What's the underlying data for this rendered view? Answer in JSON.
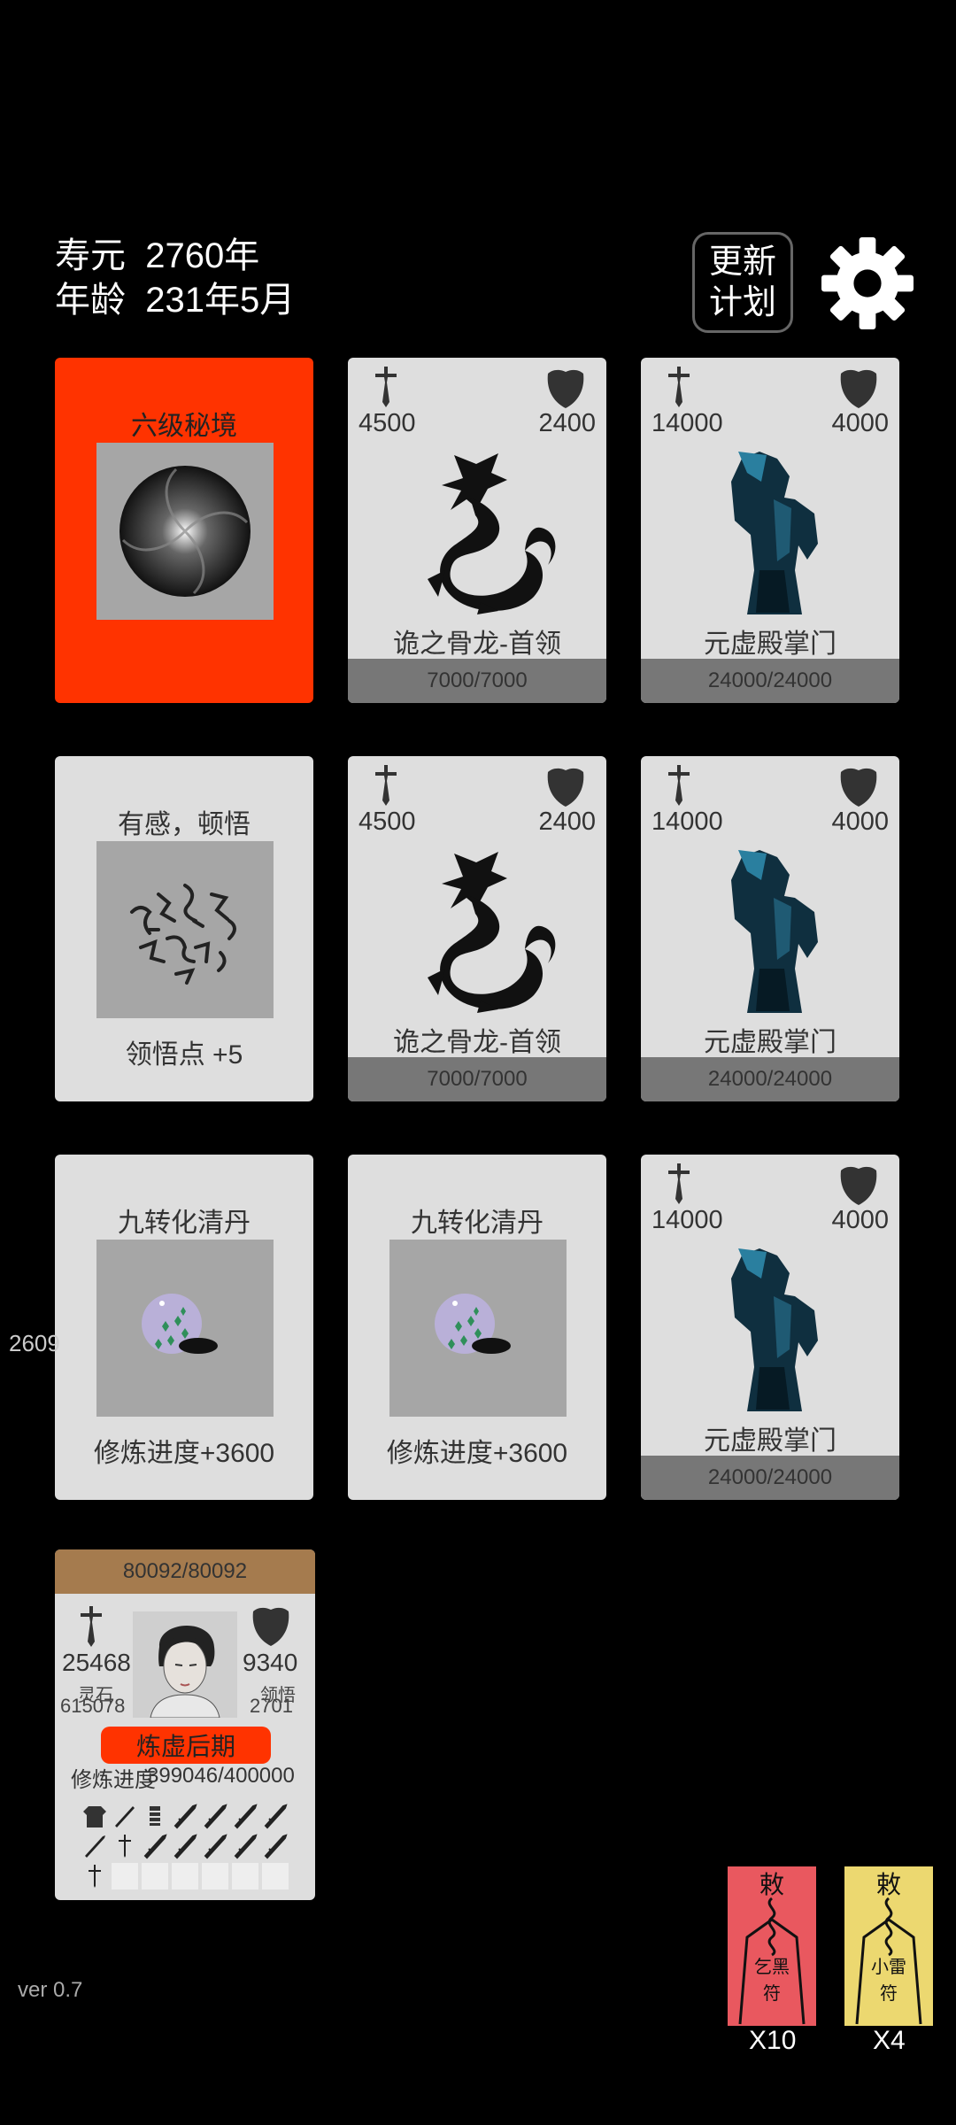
{
  "header": {
    "lifespan_label": "寿元",
    "lifespan_value": "2760年",
    "age_label": "年龄",
    "age_value": "231年5月",
    "update_btn_line1": "更新",
    "update_btn_line2": "计划"
  },
  "cards": [
    {
      "kind": "realm",
      "title": "六级秘境",
      "icon": "vortex-icon"
    },
    {
      "kind": "enemy",
      "atk": "4500",
      "def": "2400",
      "name": "诡之骨龙-首领",
      "hp": "7000/7000",
      "icon": "dragon-icon"
    },
    {
      "kind": "enemy",
      "atk": "14000",
      "def": "4000",
      "name": "元虚殿掌门",
      "hp": "24000/24000",
      "icon": "sect-master-icon"
    },
    {
      "kind": "insight",
      "title": "有感，顿悟",
      "subtitle": "领悟点  +5",
      "icon": "calligraphy-icon"
    },
    {
      "kind": "enemy",
      "atk": "4500",
      "def": "2400",
      "name": "诡之骨龙-首领",
      "hp": "7000/7000",
      "icon": "dragon-icon"
    },
    {
      "kind": "enemy",
      "atk": "14000",
      "def": "4000",
      "name": "元虚殿掌门",
      "hp": "24000/24000",
      "icon": "sect-master-icon"
    },
    {
      "kind": "pill",
      "title": "九转化清丹",
      "subtitle": "修炼进度+3600",
      "icon": "pill-icon"
    },
    {
      "kind": "pill",
      "title": "九转化清丹",
      "subtitle": "修炼进度+3600",
      "icon": "pill-icon"
    },
    {
      "kind": "enemy",
      "atk": "14000",
      "def": "4000",
      "name": "元虚殿掌门",
      "hp": "24000/24000",
      "icon": "sect-master-icon"
    }
  ],
  "side_number": "2609",
  "player": {
    "hp": "80092/80092",
    "atk": "25468",
    "def": "9340",
    "stone_label": "灵石",
    "stone_value": "615078",
    "insight_label": "领悟",
    "insight_value": "2701",
    "realm": "炼虚后期",
    "progress_label": "修炼进度",
    "progress_value": "399046/400000"
  },
  "talismans": [
    {
      "text_top": "敕",
      "text_mid": "乞黑",
      "text_bottom": "符",
      "count": "X10",
      "color": "#ea5a62"
    },
    {
      "text_top": "敕",
      "text_mid": "小雷",
      "text_bottom": "符",
      "count": "X4",
      "color": "#ecd870"
    }
  ],
  "version": "ver 0.7"
}
